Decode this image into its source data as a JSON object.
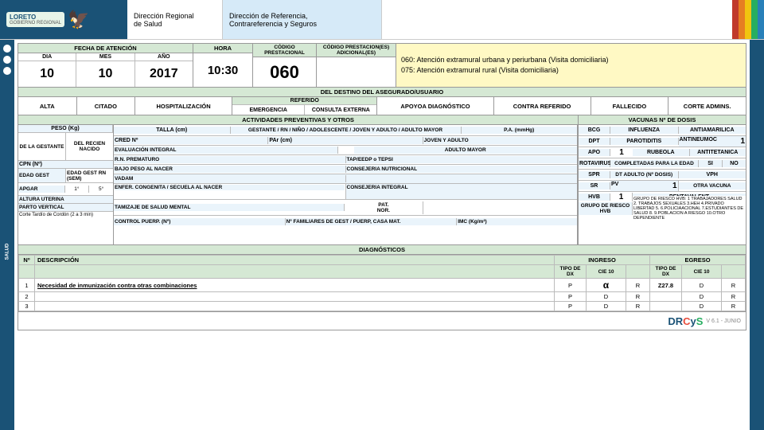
{
  "header": {
    "logo_main": "LORETO",
    "logo_sub": "GOBIERNO REGIONAL",
    "dept_line1": "Dirección Regional",
    "dept_line2": "de Salud",
    "ref_line1": "Dirección de Referencia,",
    "ref_line2": "Contrareferencia y Seguros"
  },
  "fecha": {
    "title": "FECHA DE ATENCIÓN",
    "dia_label": "DIA",
    "mes_label": "MES",
    "ano_label": "AÑO",
    "dia_val": "10",
    "mes_val": "10",
    "ano_val": "2017",
    "hora_label": "HORA",
    "hora_val": "10:30",
    "cod_prest_label": "CÓDIGO PRESTACIONAL",
    "cod_prest_val": "060",
    "cod_prest_add_label": "CÓDIGO PRESTACION(ES) ADICIONAL(ES)"
  },
  "tooltip": {
    "line1": "060: Atención extramural urbana y periurbana (Visita domiciliaria)",
    "line2": "075: Atención extramural rural (Visita domiciliaria)"
  },
  "destino": {
    "title": "DEL DESTINO DEL ASEGURADO/USUARIO",
    "alta": "ALTA",
    "citado": "CITADO",
    "hospitalizacion": "HOSPITALIZACIÓN",
    "referido": "REFERIDO",
    "emergencia": "EMERGENCIA",
    "consulta_externa": "CONSULTA EXTERNA",
    "apoyo_diag": "APOYOA DIAGNÓSTICO",
    "contra_referido": "CONTRA REFERIDO",
    "fallecido": "FALLECIDO",
    "corte_admins": "CORTE ADMINS."
  },
  "activities": {
    "title": "ACTIVIDADES PREVENTIVAS Y OTROS",
    "peso_label": "PESO (Kg)",
    "gestante_label": "DE LA GESTANTE",
    "recien_nacido_label": "DEL RECIEN NACIDO",
    "talla_label": "TALLA (cm)",
    "gestante_rn_label": "GESTANTE / RN / NIÑO / ADOLESCENTE / JOVEN Y ADULTO / ADULTO MAYOR",
    "pa_label": "P.A. (mmHg)",
    "joven_adulto_label": "JOVEN Y ADULTO",
    "cpn_label": "CPN (Nº)",
    "edad_gest_rn_label": "EDAD GEST RN (SEM)",
    "cred_label": "CRED Nº",
    "par_label": "PAr (cm)",
    "eval_integral_label": "EVALUACIÓN INTEGRAL",
    "edad_gest_label": "EDAD GEST",
    "apgar_label": "APGAR",
    "apgar1": "1°",
    "apgar5": "5°",
    "adulto_mayor_label": "ADULTO MAYOR",
    "rn_prematuro_label": "R.N. PREMATURO",
    "tap_label": "TAP/EEDP o TEPSI",
    "bajo_peso_label": "BAJO PESO AL NACER",
    "consejeria_nutr_label": "CONSEJERIA NUTRICIONAL",
    "vadam_label": "VADAM",
    "altura_uterina_label": "ALTURA UTERINA",
    "parto_vertical_label": "PARTO VERTICAL",
    "corte_cordon_label": "Corte Tardío de Cordón (2 a 3 min)",
    "enfer_congenita_label": "ENFER. CONGENITA / SECUELA AL NACER",
    "consejeria_integral_label": "CONSEJERIA INTEGRAL",
    "tamizaje_label": "TAMIZAJE DE SALUD MENTAL",
    "pat_label": "PAT.",
    "nor_label": "NOR.",
    "control_puerp_label": "CONTROL PUERP. (Nº)",
    "fam_label": "Nº FAMILIARES DE GEST / PUERP, CASA MAT.",
    "imc_label": "IMC (Kg/m²)"
  },
  "vaccines": {
    "title": "VACUNAS Nº DE DOSIS",
    "bcg": "BCG",
    "influenza": "INFLUENZA",
    "antiamarilica": "ANTIAMARILICA",
    "dpt": "DPT",
    "parotiditis": "PAROTIDITIS",
    "antineumoc": "ANTINEUMOC",
    "val_antineumoc": "1",
    "apo": "APO",
    "val_apo": "1",
    "rubeola": "RUBEOLA",
    "antitetanica": "ANTITETANICA",
    "rotavirus": "ROTAVIRUS",
    "completadas_label": "COMPLETADAS PARA LA EDAD",
    "si_label": "SI",
    "no_label": "NO",
    "spr": "SPR",
    "dt_adult_label": "DT ADULTO (Nº DOSIS)",
    "vph": "VPH",
    "sr": "SR",
    "pv_label": "PV",
    "val_pv": "1",
    "otra_vacuna": "OTRA VACUNA",
    "hvb": "HVB",
    "val_hvb": "1",
    "pentavalent": "PENTAVALENT",
    "grupo_riesco": "GRUPO DE RIESCO HVB",
    "grupo_desc": "GRUPO DE RIESCO HVB: 1 TRABAJADORES SALUD 2. TRABAJOS SEXUALES 3.HEH 4.PRIVADO LIBERTAD 5. 6.POLICIAACIONAL 7.ESTUDIANTES DE SALUD 8. 9.POBLACION A RIESGO 10.OTRO DEPENDIENTE"
  },
  "diagnostics": {
    "title": "DIAGNÓSTICOS",
    "col_num": "Nº",
    "col_desc": "DESCRIPCIÓN",
    "col_ingreso": "INGRESO",
    "col_tipo_dx": "TIPO DE DX",
    "col_cie10": "CIE 10",
    "col_egreso": "EGRESO",
    "col_tipo_dx2": "TIPO DE DX",
    "col_cie10_2": "CIE 10",
    "rows": [
      {
        "num": "1",
        "desc": "Necesidad de inmunización contra otras combinaciones",
        "tipo_p": "P",
        "tipo_d": "α",
        "tipo_r": "R",
        "cie10": "Z27.8",
        "egr_tipo_p": "D",
        "egr_tipo_r": "R"
      },
      {
        "num": "2",
        "desc": "",
        "tipo_p": "P",
        "tipo_d": "D",
        "tipo_r": "R",
        "cie10": "",
        "egr_tipo_p": "D",
        "egr_tipo_r": "R"
      },
      {
        "num": "3",
        "desc": "",
        "tipo_p": "P",
        "tipo_d": "D",
        "tipo_r": "R",
        "cie10": "",
        "egr_tipo_p": "D",
        "egr_tipo_r": "R"
      }
    ]
  },
  "footer": {
    "logo": "DRCyS",
    "version": "V 6.1 - JUNIO"
  }
}
